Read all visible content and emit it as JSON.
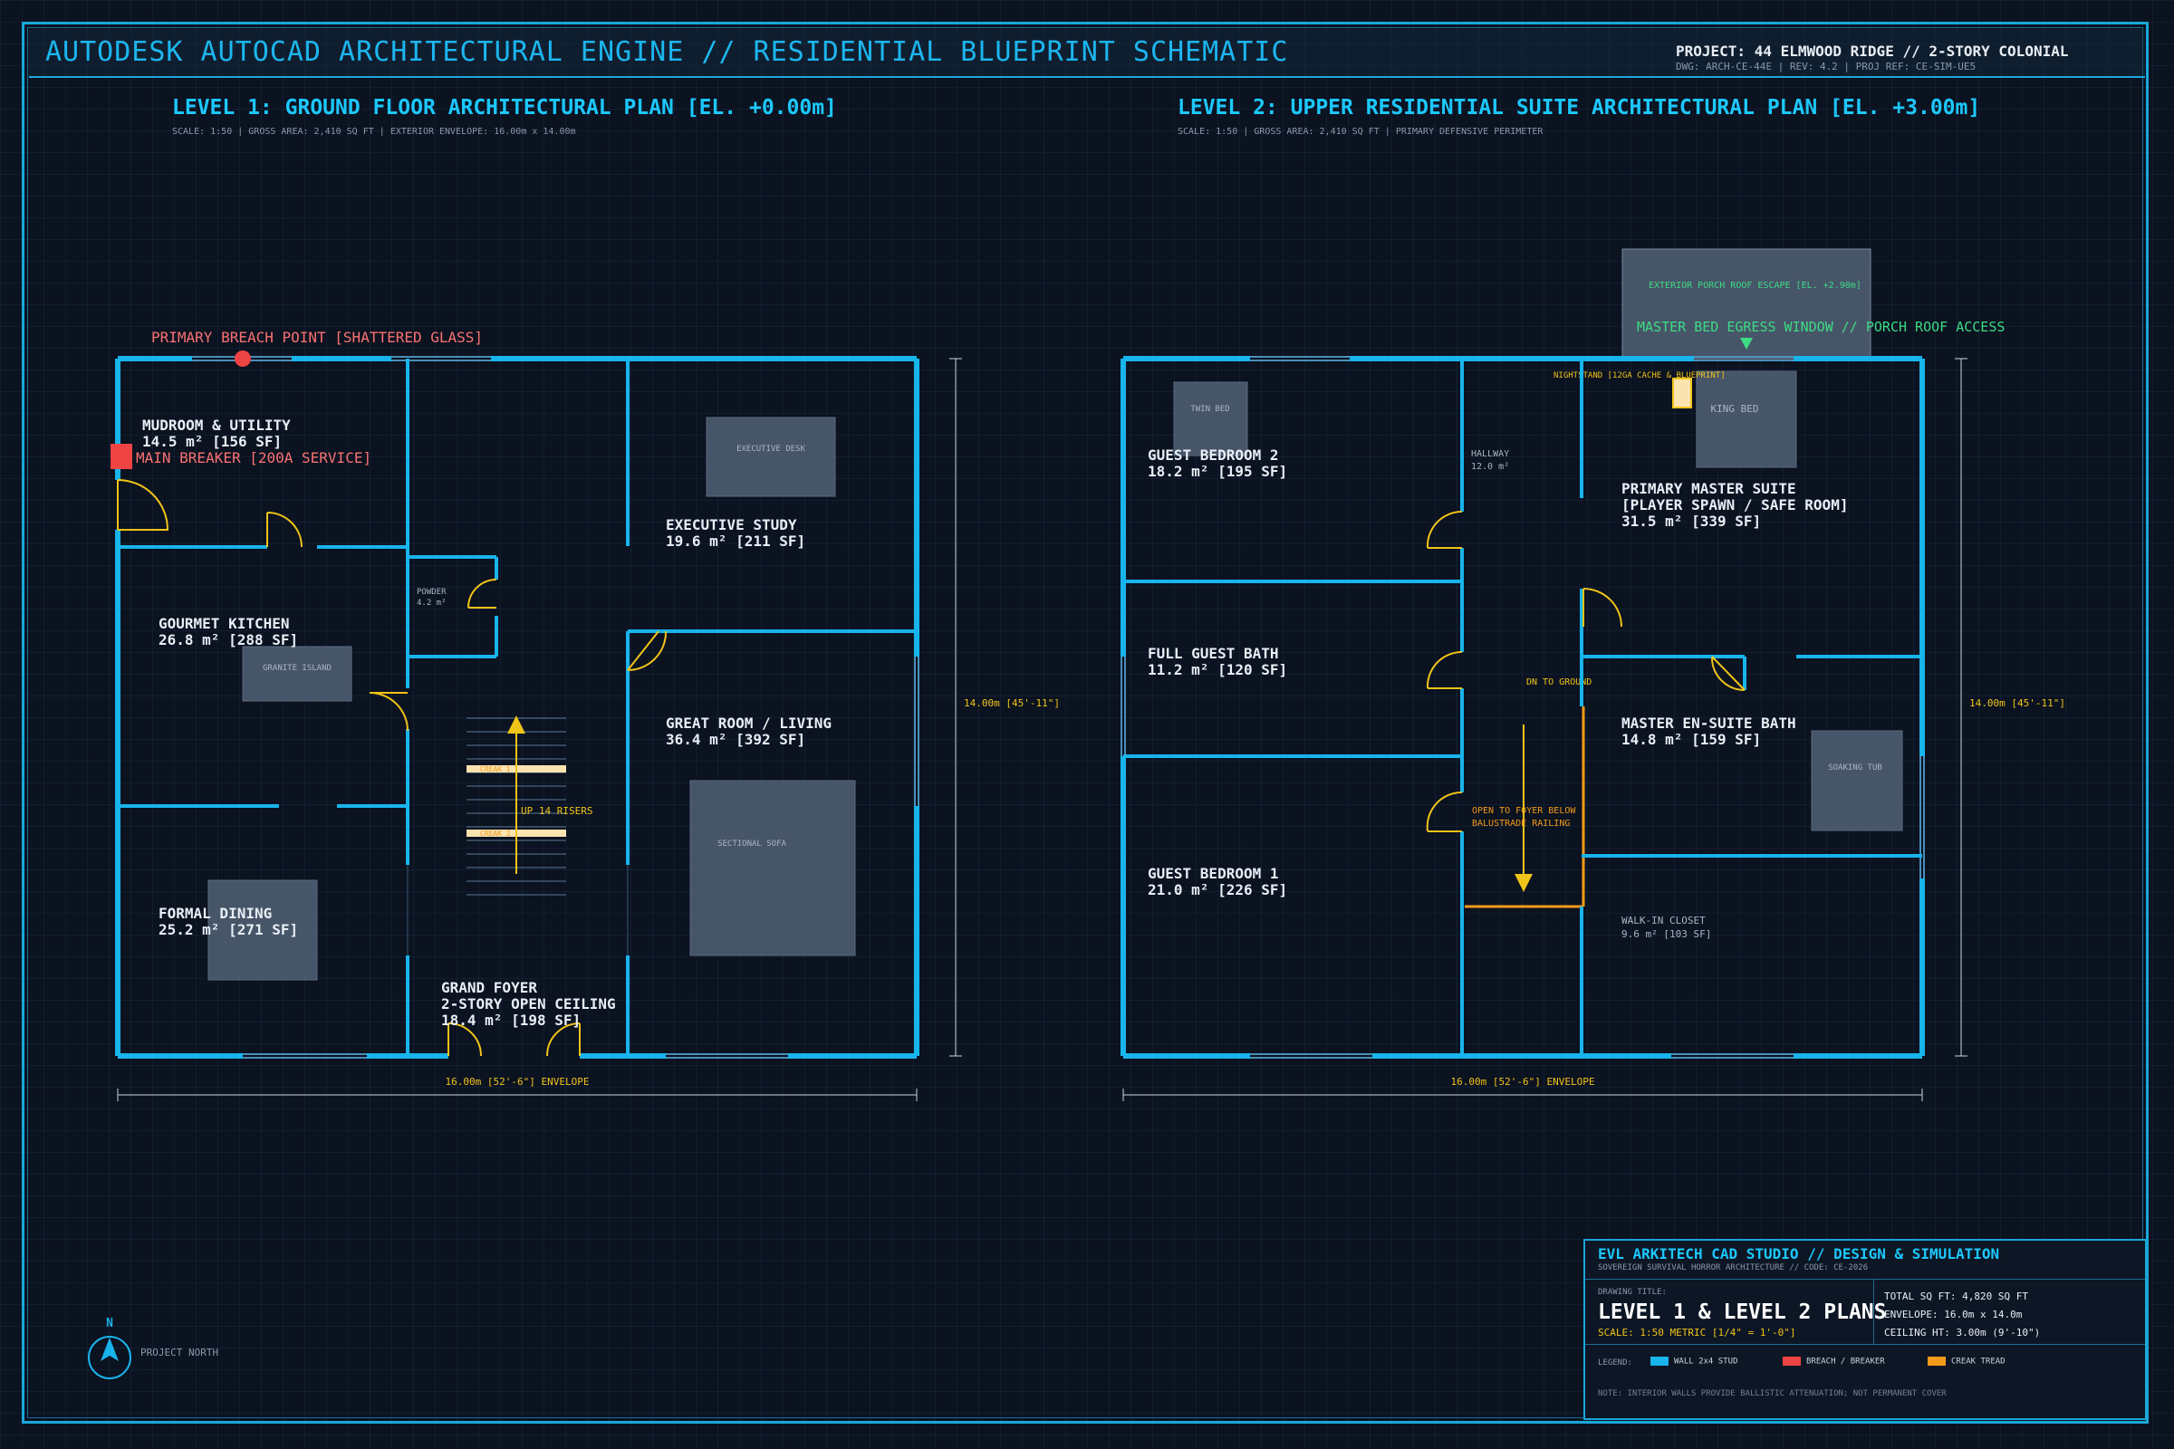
{
  "header": {
    "app_title": "AUTODESK AUTOCAD ARCHITECTURAL ENGINE // RESIDENTIAL BLUEPRINT SCHEMATIC",
    "project": "PROJECT: 44 ELMWOOD RIDGE // 2-STORY COLONIAL",
    "meta": "DWG: ARCH-CE-44E  |  REV: 4.2  |  PROJ REF: CE-SIM-UE5"
  },
  "level1": {
    "title": "LEVEL 1: GROUND FLOOR ARCHITECTURAL PLAN [EL. +0.00m]",
    "subtitle": "SCALE: 1:50 | GROSS AREA: 2,410 SQ FT | EXTERIOR ENVELOPE: 16.00m x 14.00m",
    "breach": "PRIMARY BREACH POINT [SHATTERED GLASS]",
    "breaker": "MAIN BREAKER [200A SERVICE]",
    "mudroom_name": "MUDROOM & UTILITY",
    "mudroom_area": "14.5 m² [156 SF]",
    "kitchen_name": "GOURMET KITCHEN",
    "kitchen_area": "26.8 m² [288 SF]",
    "island": "GRANITE ISLAND",
    "dining_name": "FORMAL DINING",
    "dining_area": "25.2 m² [271 SF]",
    "powder_name": "POWDER",
    "powder_area": "4.2 m²",
    "stairs": "UP 14 RISERS",
    "creak1": "CREAK 1",
    "creak2": "CREAK 2",
    "foyer_name": "GRAND FOYER",
    "foyer_desc": "2-STORY OPEN CEILING",
    "foyer_area": "18.4 m² [198 SF]",
    "study_name": "EXECUTIVE STUDY",
    "study_area": "19.6 m² [211 SF]",
    "desk": "EXECUTIVE DESK",
    "great_name": "GREAT ROOM / LIVING",
    "great_area": "36.4 m² [392 SF]",
    "sofa": "SECTIONAL SOFA",
    "dim_h": "16.00m [52'-6\"] ENVELOPE",
    "dim_v": "14.00m [45'-11\"]"
  },
  "level2": {
    "title": "LEVEL 2: UPPER RESIDENTIAL SUITE ARCHITECTURAL PLAN [EL. +3.00m]",
    "subtitle": "SCALE: 1:50 | GROSS AREA: 2,410 SQ FT | PRIMARY DEFENSIVE PERIMETER",
    "porch": "EXTERIOR PORCH ROOF ESCAPE [EL. +2.90m]",
    "egress": "MASTER BED EGRESS WINDOW // PORCH ROOF ACCESS",
    "nightstand": "NIGHTSTAND [12GA CACHE & BLUEPRINT]",
    "twin_bed": "TWIN BED",
    "guest2_name": "GUEST BEDROOM 2",
    "guest2_area": "18.2 m² [195 SF]",
    "hallway_name": "HALLWAY",
    "hallway_area": "12.0 m²",
    "king_bed": "KING BED",
    "master_name": "PRIMARY MASTER SUITE",
    "master_tag": "[PLAYER SPAWN / SAFE ROOM]",
    "master_area": "31.5 m² [339 SF]",
    "bath_name": "FULL GUEST BATH",
    "bath_area": "11.2 m² [120 SF]",
    "dn": "DN TO GROUND",
    "ensuite_name": "MASTER EN-SUITE BATH",
    "ensuite_area": "14.8 m² [159 SF]",
    "tub": "SOAKING TUB",
    "open1": "OPEN TO FOYER BELOW",
    "open2": "BALUSTRADE RAILING",
    "guest1_name": "GUEST BEDROOM 1",
    "guest1_area": "21.0 m² [226 SF]",
    "closet_name": "WALK-IN CLOSET",
    "closet_area": "9.6 m² [103 SF]",
    "dim_h": "16.00m [52'-6\"] ENVELOPE",
    "dim_v": "14.00m [45'-11\"]"
  },
  "compass": {
    "n": "N",
    "label": "PROJECT NORTH"
  },
  "title_block": {
    "studio": "EVL ARKITECH CAD STUDIO // DESIGN & SIMULATION",
    "sub": "SOVEREIGN SURVIVAL HORROR ARCHITECTURE // CODE: CE-2026",
    "drawing_label": "DRAWING TITLE:",
    "drawing_title": "LEVEL 1 & LEVEL 2 PLANS",
    "scale": "SCALE: 1:50 METRIC [1/4\" = 1'-0\"]",
    "total": "TOTAL SQ FT: 4,820 SQ FT",
    "envelope": "ENVELOPE: 16.0m x 14.0m",
    "ceiling": "CEILING HT: 3.00m (9'-10\")",
    "legend_label": "LEGEND:",
    "legend_wall": "WALL 2x4 STUD",
    "legend_breach": "BREACH / BREAKER",
    "legend_creak": "CREAK TREAD",
    "note": "NOTE: INTERIOR WALLS PROVIDE BALLISTIC ATTENUATION; NOT PERMANENT COVER"
  },
  "colors": {
    "wall": "#18b4ec",
    "door": "#f0c419",
    "breach": "#ef4444",
    "creak": "#f29b1b",
    "egress": "#3ddc84",
    "furniture": "#475569"
  }
}
